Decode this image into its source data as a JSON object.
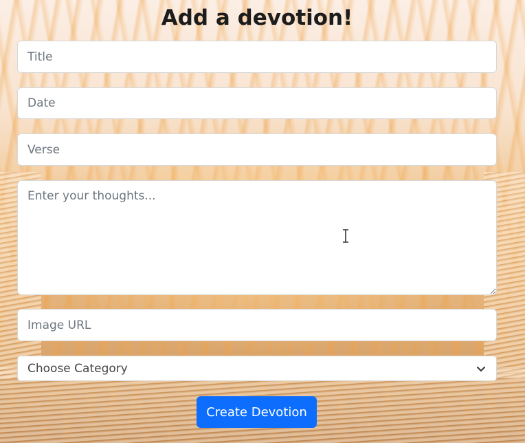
{
  "form": {
    "heading": "Add a devotion!",
    "title_placeholder": "Title",
    "date_placeholder": "Date",
    "verse_placeholder": "Verse",
    "thoughts_placeholder": "Enter your thoughts...",
    "image_url_placeholder": "Image URL",
    "category_selected": "Choose Category",
    "submit_label": "Create Devotion"
  },
  "icons": {
    "select_arrow": "chevron-down-icon",
    "text_cursor": "text-cursor-icon"
  },
  "colors": {
    "primary_button": "#0d6efd",
    "heading_text": "#1c1c1c"
  }
}
